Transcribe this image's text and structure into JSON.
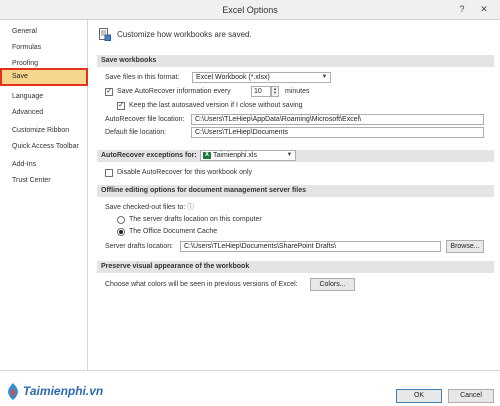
{
  "window": {
    "title": "Excel Options",
    "help_glyph": "?",
    "close_glyph": "✕"
  },
  "sidebar": {
    "items": [
      {
        "label": "General"
      },
      {
        "label": "Formulas"
      },
      {
        "label": "Proofing"
      },
      {
        "label": "Save",
        "selected": true
      },
      {
        "label": "Language"
      },
      {
        "label": "Advanced"
      },
      {
        "label": "Customize Ribbon"
      },
      {
        "label": "Quick Access Toolbar"
      },
      {
        "label": "Add-Ins"
      },
      {
        "label": "Trust Center"
      }
    ]
  },
  "main": {
    "header": "Customize how workbooks are saved.",
    "save_workbooks": {
      "title": "Save workbooks",
      "format_label": "Save files in this format:",
      "format_value": "Excel Workbook (*.xlsx)",
      "autorecover_label": "Save AutoRecover information every",
      "autorecover_checked": true,
      "autorecover_minutes": "10",
      "minutes_label": "minutes",
      "keep_last_label": "Keep the last autosaved version if I close without saving",
      "keep_last_checked": true,
      "ar_location_label": "AutoRecover file location:",
      "ar_location_value": "C:\\Users\\TLeHiep\\AppData\\Roaming\\Microsoft\\Excel\\",
      "default_location_label": "Default file location:",
      "default_location_value": "C:\\Users\\TLeHiep\\Documents"
    },
    "ar_exceptions": {
      "title": "AutoRecover exceptions for:",
      "workbook": "Taimienphi.xls",
      "disable_label": "Disable AutoRecover for this workbook only",
      "disable_checked": false
    },
    "offline": {
      "title": "Offline editing options for document management server files",
      "save_to_label": "Save checked-out files to:",
      "option_server": "The server drafts location on this computer",
      "option_cache": "The Office Document Cache",
      "selected_option": "cache",
      "drafts_label": "Server drafts location:",
      "drafts_value": "C:\\Users\\TLeHiep\\Documents\\SharePoint Drafts\\",
      "browse_label": "Browse..."
    },
    "preserve": {
      "title": "Preserve visual appearance of the workbook",
      "colors_label": "Choose what colors will be seen in previous versions of Excel:",
      "colors_button": "Colors..."
    }
  },
  "footer": {
    "ok_label": "OK",
    "cancel_label": "Cancel"
  },
  "watermark": {
    "text": "Taimienphi.vn"
  },
  "colors": {
    "selected_fill": "#f6d68b",
    "selected_border": "#e0321e",
    "excel_green": "#1f7a3a"
  }
}
